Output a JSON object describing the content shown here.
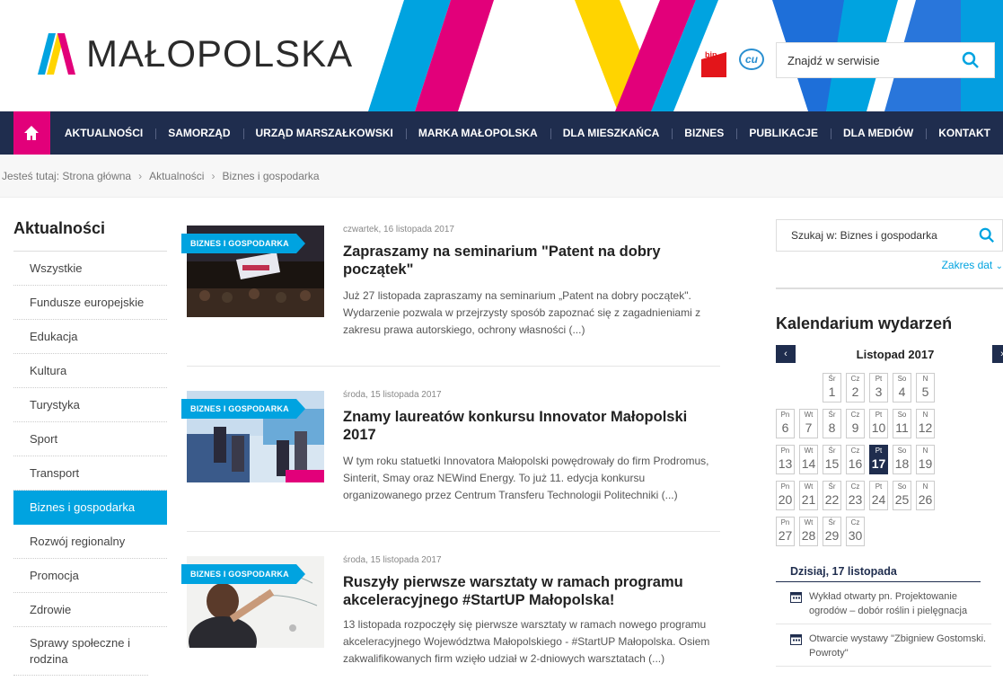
{
  "header": {
    "logo_text": "MAŁOPOLSKA",
    "bip_label": "bip",
    "cu_label": "cu",
    "search_placeholder": "Znajdź w serwisie"
  },
  "nav": {
    "items": [
      "AKTUALNOŚCI",
      "SAMORZĄD",
      "URZĄD MARSZAŁKOWSKI",
      "MARKA MAŁOPOLSKA",
      "DLA MIESZKAŃCA",
      "BIZNES",
      "PUBLIKACJE",
      "DLA MEDIÓW",
      "KONTAKT"
    ]
  },
  "breadcrumb": {
    "prefix": "Jesteś tutaj: Strona główna",
    "items": [
      "Aktualności",
      "Biznes i gospodarka"
    ]
  },
  "sidebar": {
    "title": "Aktualności",
    "items": [
      "Wszystkie",
      "Fundusze europejskie",
      "Edukacja",
      "Kultura",
      "Turystyka",
      "Sport",
      "Transport",
      "Biznes i gospodarka",
      "Rozwój regionalny",
      "Promocja",
      "Zdrowie",
      "Sprawy społeczne i rodzina"
    ],
    "active": "Biznes i gospodarka"
  },
  "articles": [
    {
      "tag": "BIZNES I GOSPODARKA",
      "date": "czwartek, 16 listopada 2017",
      "title": "Zapraszamy na seminarium \"Patent na dobry początek\"",
      "body": "Już 27 listopada zapraszamy na seminarium „Patent na dobry początek\". Wydarzenie pozwala w przejrzysty sposób zapoznać się z zagadnieniami z zakresu prawa autorskiego, ochrony własności (...)"
    },
    {
      "tag": "BIZNES I GOSPODARKA",
      "date": "środa, 15 listopada 2017",
      "title": "Znamy laureatów konkursu Innovator Małopolski 2017",
      "body": "W tym roku statuetki Innovatora Małopolski powędrowały do firm Prodromus, Sinterit, Smay oraz NEWind Energy. To już 11. edycja konkursu organizowanego przez Centrum Transferu Technologii Politechniki (...)"
    },
    {
      "tag": "BIZNES I GOSPODARKA",
      "date": "środa, 15 listopada 2017",
      "title": "Ruszyły pierwsze warsztaty w ramach programu akceleracyjnego #StartUP Małopolska!",
      "body": "13 listopada rozpoczęły się pierwsze warsztaty w ramach nowego programu akceleracyjnego Województwa Małopolskiego - #StartUP Małopolska. Osiem zakwalifikowanych firm wzięło udział w 2-dniowych warsztatach (...)"
    }
  ],
  "right": {
    "search_label": "Szukaj w: Biznes i gospodarka",
    "date_range": "Zakres dat",
    "calendar_title": "Kalendarium wydarzeń",
    "month": "Listopad 2017",
    "days": [
      {
        "dn": "Śr",
        "d": "1"
      },
      {
        "dn": "Cz",
        "d": "2"
      },
      {
        "dn": "Pt",
        "d": "3"
      },
      {
        "dn": "So",
        "d": "4"
      },
      {
        "dn": "N",
        "d": "5"
      },
      {
        "dn": "Pn",
        "d": "6"
      },
      {
        "dn": "Wt",
        "d": "7"
      },
      {
        "dn": "Śr",
        "d": "8"
      },
      {
        "dn": "Cz",
        "d": "9"
      },
      {
        "dn": "Pt",
        "d": "10"
      },
      {
        "dn": "So",
        "d": "11"
      },
      {
        "dn": "N",
        "d": "12"
      },
      {
        "dn": "Pn",
        "d": "13"
      },
      {
        "dn": "Wt",
        "d": "14"
      },
      {
        "dn": "Śr",
        "d": "15"
      },
      {
        "dn": "Cz",
        "d": "16"
      },
      {
        "dn": "Pt",
        "d": "17"
      },
      {
        "dn": "So",
        "d": "18"
      },
      {
        "dn": "N",
        "d": "19"
      },
      {
        "dn": "Pn",
        "d": "20"
      },
      {
        "dn": "Wt",
        "d": "21"
      },
      {
        "dn": "Śr",
        "d": "22"
      },
      {
        "dn": "Cz",
        "d": "23"
      },
      {
        "dn": "Pt",
        "d": "24"
      },
      {
        "dn": "So",
        "d": "25"
      },
      {
        "dn": "N",
        "d": "26"
      },
      {
        "dn": "Pn",
        "d": "27"
      },
      {
        "dn": "Wt",
        "d": "28"
      },
      {
        "dn": "Śr",
        "d": "29"
      },
      {
        "dn": "Cz",
        "d": "30"
      }
    ],
    "today_day": "17",
    "today_heading": "Dzisiaj, 17 listopada",
    "events": [
      "Wykład otwarty pn. Projektowanie ogrodów – dobór roślin i pielęgnacja",
      "Otwarcie wystawy \"Zbigniew Gostomski. Powroty\""
    ]
  },
  "colors": {
    "navy": "#1f2d4e",
    "magenta": "#e2007a",
    "cyan": "#00a3e0",
    "yellow": "#ffd400",
    "blue": "#1e6fd9"
  }
}
